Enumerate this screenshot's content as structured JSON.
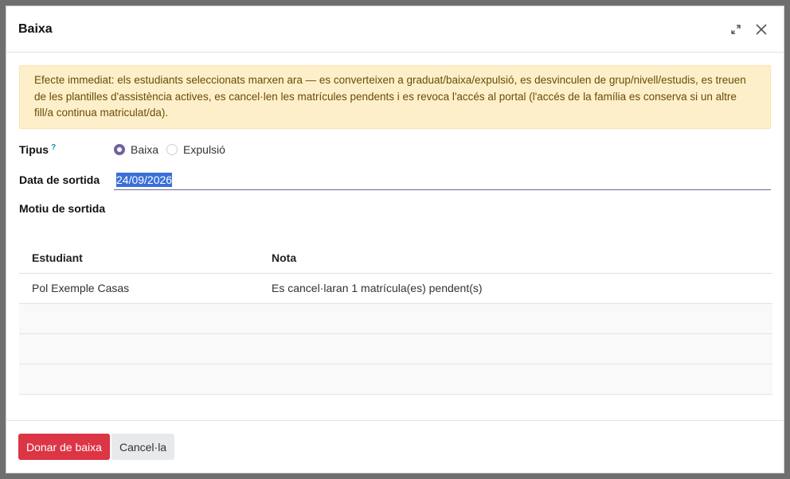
{
  "dialog": {
    "title": "Baixa",
    "expand_icon": "expand-arrows-icon",
    "close_icon": "close-x-icon"
  },
  "alert": {
    "text": "Efecte immediat: els estudiants seleccionats marxen ara — es converteixen a graduat/baixa/expulsió, es desvinculen de grup/nivell/estudis, es treuen de les plantilles d'assistència actives, es cancel·len les matrícules pendents i es revoca l'accés al portal (l'accés de la família es conserva si un altre fill/a continua matriculat/da)."
  },
  "form": {
    "type_label": "Tipus",
    "type_help": "?",
    "type_options": [
      {
        "label": "Baixa",
        "checked": true
      },
      {
        "label": "Expulsió",
        "checked": false
      }
    ],
    "date_label": "Data de sortida",
    "date_value": "24/09/2026",
    "reason_label": "Motiu de sortida"
  },
  "table": {
    "columns": [
      "Estudiant",
      "Nota"
    ],
    "rows": [
      {
        "student": "Pol Exemple Casas",
        "note": "Es cancel·laran 1 matrícula(es) pendent(s)"
      }
    ]
  },
  "footer": {
    "confirm_label": "Donar de baixa",
    "cancel_label": "Cancel·la"
  },
  "colors": {
    "primary_danger": "#dc3545",
    "accent": "#71639e",
    "alert_bg": "#fdefc9"
  }
}
